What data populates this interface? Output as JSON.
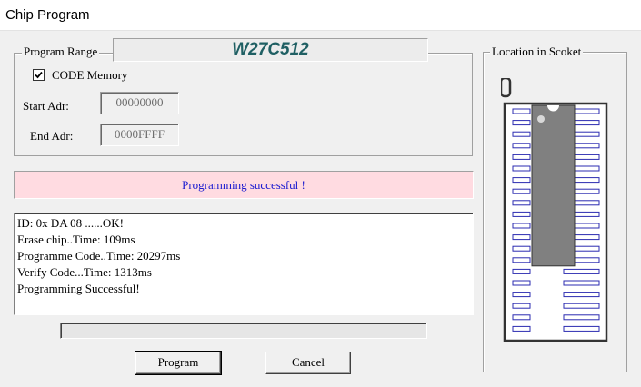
{
  "window": {
    "title": "Chip Program"
  },
  "program_range": {
    "legend": "Program Range",
    "chip_name": "W27C512",
    "code_memory_label": "CODE Memory",
    "code_memory_checked": true,
    "start_adr_label": "Start Adr:",
    "start_adr_value": "00000000",
    "end_adr_label": "End Adr:",
    "end_adr_value": "0000FFFF"
  },
  "status": {
    "message": "Programming successful !"
  },
  "log": {
    "lines": [
      "ID: 0x DA 08 ......OK!",
      "Erase chip..Time: 109ms",
      "Programme Code..Time: 20297ms",
      "Verify Code...Time: 1313ms",
      "Programming Successful!"
    ]
  },
  "progress": {
    "value_percent": 0
  },
  "buttons": {
    "program": "Program",
    "cancel": "Cancel"
  },
  "socket": {
    "legend": "Location in Scoket",
    "pins_per_side": 20,
    "chip_pins_per_side": 14,
    "chip_color": "#808080",
    "pin_color": "#2b2bb0"
  }
}
